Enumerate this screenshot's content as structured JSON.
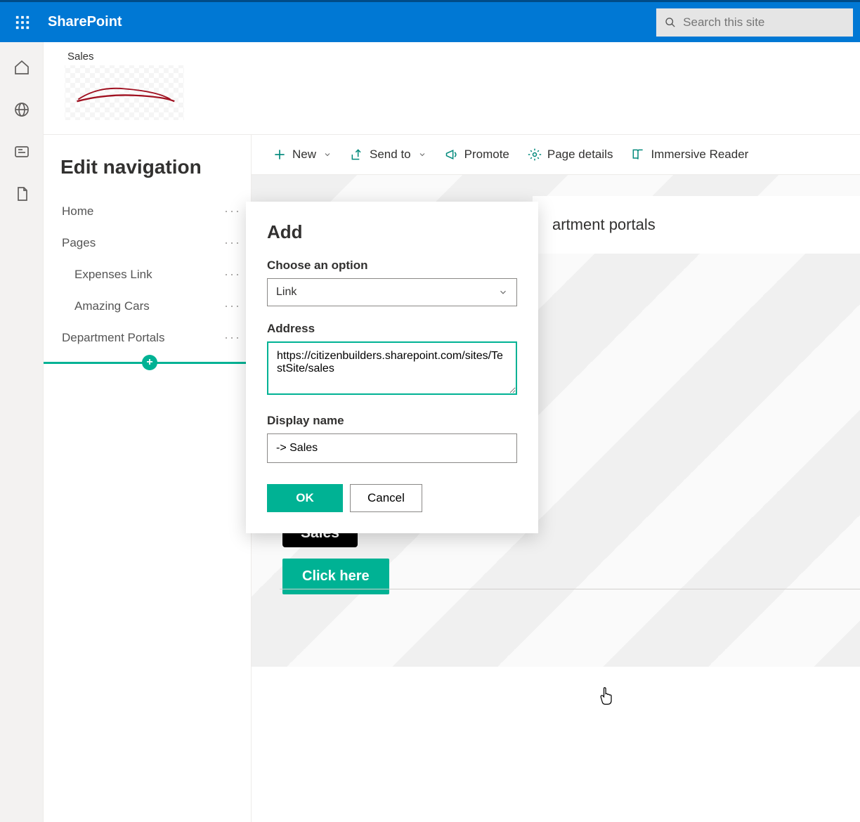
{
  "brand": "SharePoint",
  "search": {
    "placeholder": "Search this site"
  },
  "site": {
    "name": "Sales"
  },
  "nav": {
    "title": "Edit navigation",
    "items": [
      {
        "label": "Home",
        "sub": false
      },
      {
        "label": "Pages",
        "sub": false
      },
      {
        "label": "Expenses Link",
        "sub": true
      },
      {
        "label": "Amazing Cars",
        "sub": true
      },
      {
        "label": "Department Portals",
        "sub": false
      }
    ]
  },
  "commandbar": {
    "new": "New",
    "send_to": "Send to",
    "promote": "Promote",
    "page_details": "Page details",
    "immersive_reader": "Immersive Reader"
  },
  "dialog": {
    "title": "Add",
    "option_label": "Choose an option",
    "option_value": "Link",
    "address_label": "Address",
    "address_value": "https://citizenbuilders.sharepoint.com/sites/TestSite/sales",
    "displayname_label": "Display name",
    "displayname_value": "-> Sales",
    "ok": "OK",
    "cancel": "Cancel"
  },
  "page_content": {
    "partial_title_suffix": "artment portals",
    "sales_label": "Sales",
    "click_here": "Click here"
  }
}
